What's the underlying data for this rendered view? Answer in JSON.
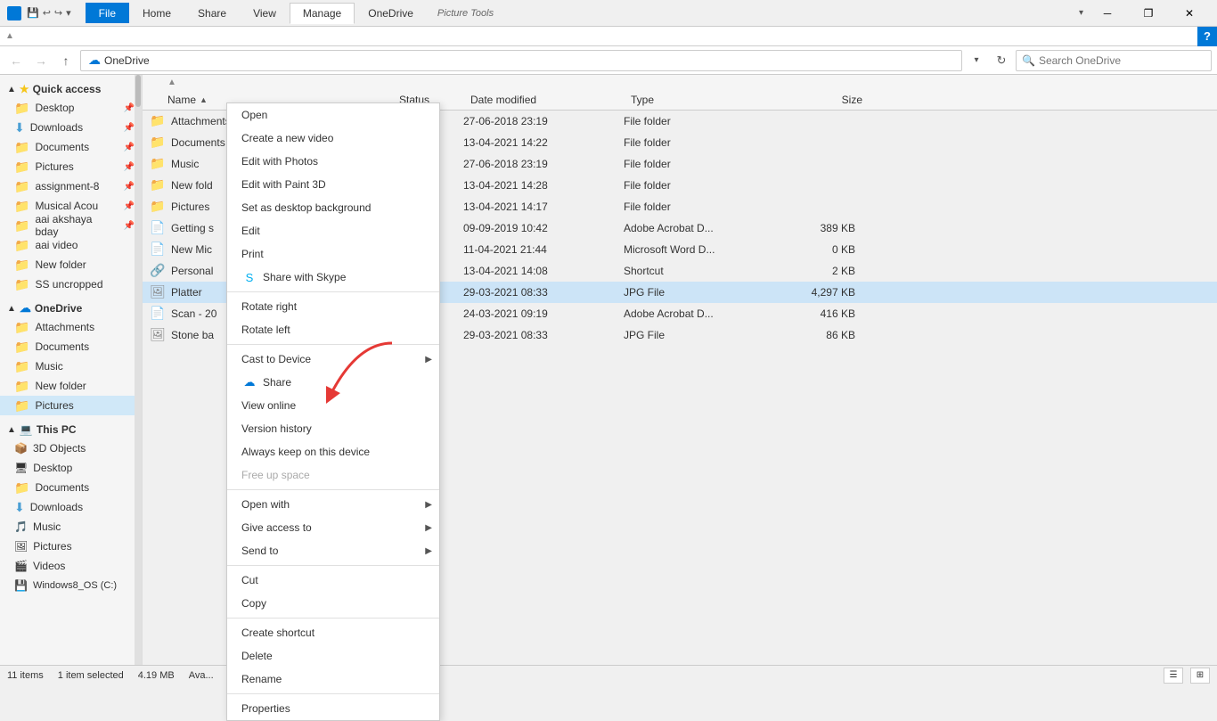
{
  "titlebar": {
    "tabs": [
      {
        "label": "File",
        "active": true,
        "accent": true
      },
      {
        "label": "Home",
        "active": false
      },
      {
        "label": "Share",
        "active": false
      },
      {
        "label": "View",
        "active": false
      },
      {
        "label": "Manage",
        "active": true,
        "underline": true
      },
      {
        "label": "OneDrive",
        "active": false
      }
    ],
    "picture_tools_label": "Picture Tools",
    "window_title": "OneDrive",
    "minimize": "─",
    "restore": "❐",
    "close": "✕"
  },
  "ribbon_tabs": [
    {
      "label": "File",
      "active": true
    },
    {
      "label": "Home"
    },
    {
      "label": "Share"
    },
    {
      "label": "View"
    },
    {
      "label": "Manage"
    },
    {
      "label": "OneDrive"
    }
  ],
  "addressbar": {
    "breadcrumb": "OneDrive",
    "search_placeholder": "Search OneDrive"
  },
  "sidebar": {
    "quick_access_label": "Quick access",
    "items_quick": [
      {
        "label": "Desktop",
        "pinned": true
      },
      {
        "label": "Downloads",
        "pinned": true
      },
      {
        "label": "Documents",
        "pinned": true
      },
      {
        "label": "Pictures",
        "pinned": true
      },
      {
        "label": "assignment-8",
        "pinned": true
      },
      {
        "label": "Musical Acou",
        "pinned": true
      },
      {
        "label": "aai akshaya bday",
        "pinned": true
      },
      {
        "label": "aai video",
        "pinned": false
      },
      {
        "label": "New folder",
        "pinned": false
      },
      {
        "label": "SS uncropped",
        "pinned": false
      }
    ],
    "onedrive_label": "OneDrive",
    "items_onedrive": [
      {
        "label": "Attachments"
      },
      {
        "label": "Documents"
      },
      {
        "label": "Music"
      },
      {
        "label": "New folder"
      },
      {
        "label": "Pictures"
      }
    ],
    "this_pc_label": "This PC",
    "items_pc": [
      {
        "label": "3D Objects"
      },
      {
        "label": "Desktop"
      },
      {
        "label": "Documents"
      },
      {
        "label": "Downloads"
      },
      {
        "label": "Music"
      },
      {
        "label": "Pictures"
      },
      {
        "label": "Videos"
      },
      {
        "label": "Windows8_OS (C:)"
      }
    ]
  },
  "columns": {
    "name": "Name",
    "status": "Status",
    "date": "Date modified",
    "type": "Type",
    "size": "Size"
  },
  "files": [
    {
      "name": "Attachments",
      "icon": "folder",
      "status": "check",
      "date": "27-06-2018 23:19",
      "type": "File folder",
      "size": ""
    },
    {
      "name": "Documents",
      "icon": "folder",
      "status": "",
      "date": "13-04-2021 14:22",
      "type": "File folder",
      "size": ""
    },
    {
      "name": "Music",
      "icon": "folder",
      "status": "",
      "date": "27-06-2018 23:19",
      "type": "File folder",
      "size": ""
    },
    {
      "name": "New fold",
      "icon": "folder",
      "status": "",
      "date": "13-04-2021 14:28",
      "type": "File folder",
      "size": ""
    },
    {
      "name": "Pictures",
      "icon": "folder",
      "status": "",
      "date": "13-04-2021 14:17",
      "type": "File folder",
      "size": ""
    },
    {
      "name": "Getting s",
      "icon": "pdf",
      "status": "",
      "date": "09-09-2019 10:42",
      "type": "Adobe Acrobat D...",
      "size": "389 KB"
    },
    {
      "name": "New Mic",
      "icon": "doc",
      "status": "",
      "date": "11-04-2021 21:44",
      "type": "Microsoft Word D...",
      "size": "0 KB"
    },
    {
      "name": "Personal",
      "icon": "lnk",
      "status": "",
      "date": "13-04-2021 14:08",
      "type": "Shortcut",
      "size": "2 KB"
    },
    {
      "name": "Platter",
      "icon": "jpg",
      "status": "",
      "date": "29-03-2021 08:33",
      "type": "JPG File",
      "size": "4,297 KB",
      "selected": true
    },
    {
      "name": "Scan - 20",
      "icon": "pdf",
      "status": "",
      "date": "24-03-2021 09:19",
      "type": "Adobe Acrobat D...",
      "size": "416 KB"
    },
    {
      "name": "Stone ba",
      "icon": "jpg",
      "status": "",
      "date": "29-03-2021 08:33",
      "type": "JPG File",
      "size": "86 KB"
    }
  ],
  "context_menu": {
    "items": [
      {
        "label": "Open",
        "type": "item"
      },
      {
        "label": "Create a new video",
        "type": "item"
      },
      {
        "label": "Edit with Photos",
        "type": "item"
      },
      {
        "label": "Edit with Paint 3D",
        "type": "item"
      },
      {
        "label": "Set as desktop background",
        "type": "item"
      },
      {
        "label": "Edit",
        "type": "item"
      },
      {
        "label": "Print",
        "type": "item"
      },
      {
        "label": "Share with Skype",
        "type": "item",
        "icon": "skype"
      },
      {
        "type": "separator"
      },
      {
        "label": "Rotate right",
        "type": "item"
      },
      {
        "label": "Rotate left",
        "type": "item"
      },
      {
        "type": "separator"
      },
      {
        "label": "Cast to Device",
        "type": "item",
        "arrow": true
      },
      {
        "label": "Share",
        "type": "item",
        "icon": "onedrive"
      },
      {
        "label": "View online",
        "type": "item"
      },
      {
        "label": "Version history",
        "type": "item"
      },
      {
        "label": "Always keep on this device",
        "type": "item"
      },
      {
        "label": "Free up space",
        "type": "item",
        "disabled": true
      },
      {
        "type": "separator"
      },
      {
        "label": "Open with",
        "type": "item",
        "arrow": true
      },
      {
        "label": "Give access to",
        "type": "item",
        "arrow": true
      },
      {
        "label": "Send to",
        "type": "item",
        "arrow": true
      },
      {
        "type": "separator"
      },
      {
        "label": "Cut",
        "type": "item"
      },
      {
        "label": "Copy",
        "type": "item"
      },
      {
        "type": "separator"
      },
      {
        "label": "Create shortcut",
        "type": "item"
      },
      {
        "label": "Delete",
        "type": "item"
      },
      {
        "label": "Rename",
        "type": "item"
      },
      {
        "type": "separator"
      },
      {
        "label": "Properties",
        "type": "item"
      }
    ]
  },
  "status_bar": {
    "count": "11 items",
    "selected": "1 item selected",
    "size": "4.19 MB",
    "available": "Ava..."
  }
}
